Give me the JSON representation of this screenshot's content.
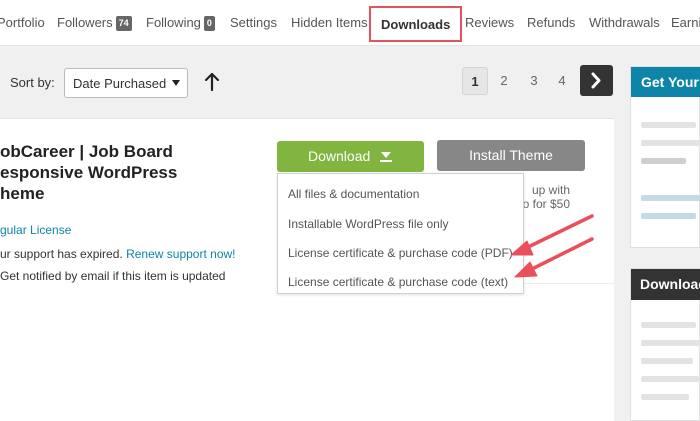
{
  "tabs": {
    "portfolio": "Portfolio",
    "followers": "Followers",
    "followers_count": "74",
    "following": "Following",
    "following_count": "0",
    "settings": "Settings",
    "hidden_items": "Hidden Items",
    "downloads": "Downloads",
    "reviews": "Reviews",
    "refunds": "Refunds",
    "withdrawals": "Withdrawals",
    "earnings": "Earni"
  },
  "sort": {
    "label": "Sort by:",
    "selected": "Date Purchased"
  },
  "pagination": {
    "pages": [
      "1",
      "2",
      "3",
      "4"
    ],
    "current": "1"
  },
  "item": {
    "title_line1": "obCareer | Job Board",
    "title_line2": "esponsive WordPress",
    "title_line3": "heme",
    "license": "gular License",
    "support_text": "ur support has expired.",
    "renew_link": "Renew support now!",
    "notify": "Get notified by email if this item is updated",
    "download_label": "Download",
    "install_label": "Install Theme",
    "upsell_line1": "up with",
    "upsell_line2": "o for $50"
  },
  "download_menu": {
    "items": [
      "All files & documentation",
      "Installable WordPress file only",
      "License certificate & purchase code (PDF)",
      "License certificate & purchase code (text)"
    ]
  },
  "sidebar": {
    "box1_title": "Get Your",
    "box2_title": "Download"
  },
  "colors": {
    "download_green": "#82b440",
    "active_tab_border": "#e2535e",
    "arrow_red": "#e8505b",
    "link_blue": "#0d84a8"
  }
}
